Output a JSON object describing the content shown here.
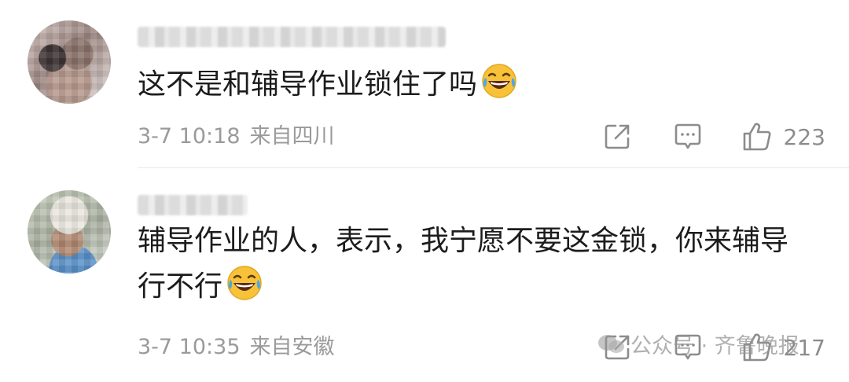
{
  "comments": [
    {
      "text": "这不是和辅导作业锁住了吗",
      "emoji": "laughing-tears-emoji",
      "date": "3-7 10:18",
      "location": "来自四川",
      "likes": "223"
    },
    {
      "text": "辅导作业的人，表示，我宁愿不要这金锁，你来辅导行不行",
      "emoji": "laughing-tears-emoji",
      "date": "3-7 10:35",
      "location": "来自安徽",
      "likes": "217"
    }
  ],
  "icons": {
    "share": "share-icon",
    "reply": "comment-icon",
    "like": "thumbs-up-icon"
  },
  "watermark": {
    "text": "公众号 · 齐鲁晚报"
  },
  "colors": {
    "text": "#1c1c1c",
    "meta": "#9a9a9a",
    "icon": "#8c8c8c",
    "emoji_face": "#f7c23a"
  }
}
